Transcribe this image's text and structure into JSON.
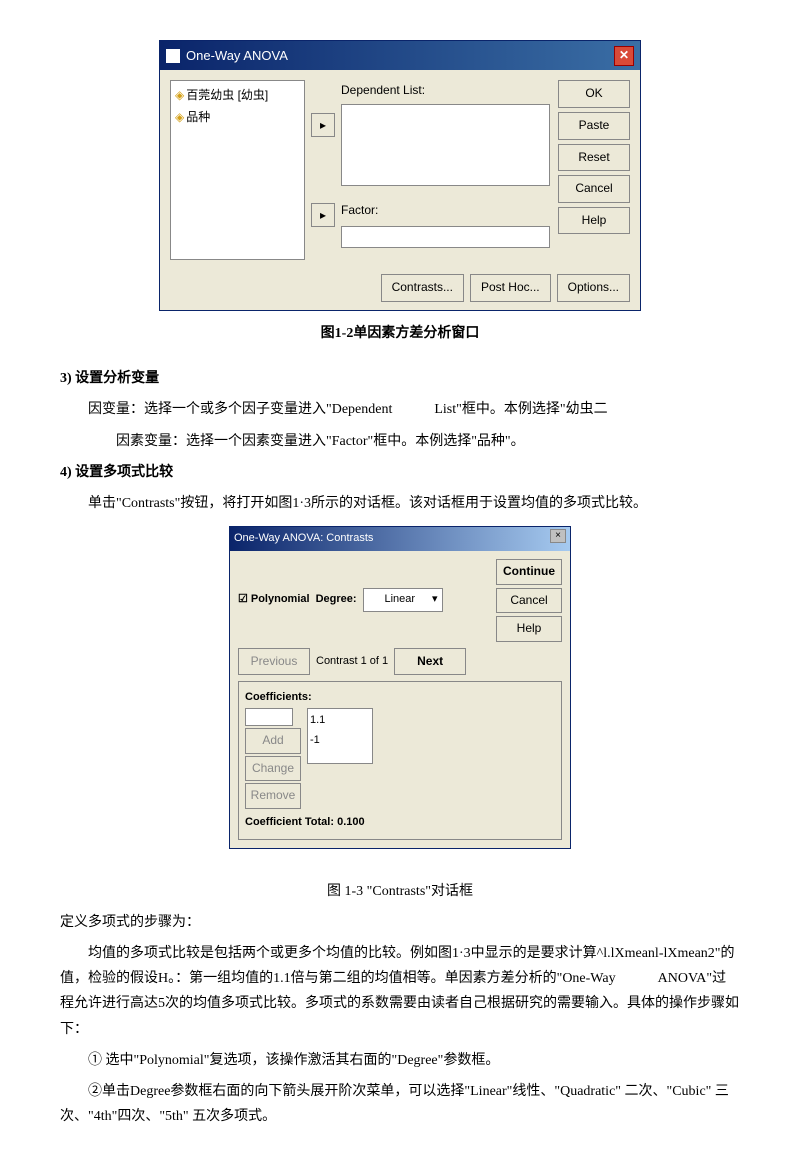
{
  "dialog1": {
    "title": "One-Way ANOVA",
    "vars": [
      "百莞幼虫 [幼虫]",
      "品种"
    ],
    "dep_label": "Dependent List:",
    "factor_label": "Factor:",
    "buttons": {
      "ok": "OK",
      "paste": "Paste",
      "reset": "Reset",
      "cancel": "Cancel",
      "help": "Help"
    },
    "bottom": {
      "contrasts": "Contrasts...",
      "posthoc": "Post Hoc...",
      "options": "Options..."
    }
  },
  "cap1": "图1-2单因素方差分析窗口",
  "p3_head": "3) 设置分析变量",
  "p3a": "因变量：选择一个或多个因子变量进入\"Dependent　　　List\"框中。本例选择\"幼虫二",
  "p3b": "因素变量：选择一个因素变量进入\"Factor\"框中。本例选择\"品种\"。",
  "p4_head": "4) 设置多项式比较",
  "p4a": "单击\"Contrasts\"按钮，将打开如图1·3所示的对话框。该对话框用于设置均值的多项式比较。",
  "dialog2": {
    "title": "One-Way ANOVA: Contrasts",
    "poly": "Polynomial",
    "degree_lbl": "Degree:",
    "degree_val": "Linear",
    "continue": "Continue",
    "cancel": "Cancel",
    "help": "Help",
    "prev": "Previous",
    "counter": "Contrast 1 of 1",
    "next": "Next",
    "coeff_lbl": "Coefficients:",
    "add": "Add",
    "change": "Change",
    "remove": "Remove",
    "list": [
      "1.1",
      "-1"
    ],
    "total": "Coefficient Total: 0.100"
  },
  "cap2": "图 1-3 \"Contrasts\"对话框",
  "p5": "定义多项式的步骤为：",
  "p6": "均值的多项式比较是包括两个或更多个均值的比较。例如图1·3中显示的是要求计算^l.lXmeanl-lXmean2\"的值，检验的假设H。：第一组均值的1.1倍与第二组的均值相等。单因素方差分析的\"One-Way　　　ANOVA\"过程允许进行高达5次的均值多项式比较。多项式的系数需要由读者自己根据研究的需要输入。具体的操作步骤如下：",
  "p7": "① 选中\"Polynomial\"复选项，该操作激活其右面的\"Degree\"参数框。",
  "p8": "②单击Degree参数框右面的向下箭头展开阶次菜单，可以选择\"Linear\"线性、\"Quadratic\" 二次、\"Cubic\" 三次、\"4th\"四次、\"5th\" 五次多项式。"
}
